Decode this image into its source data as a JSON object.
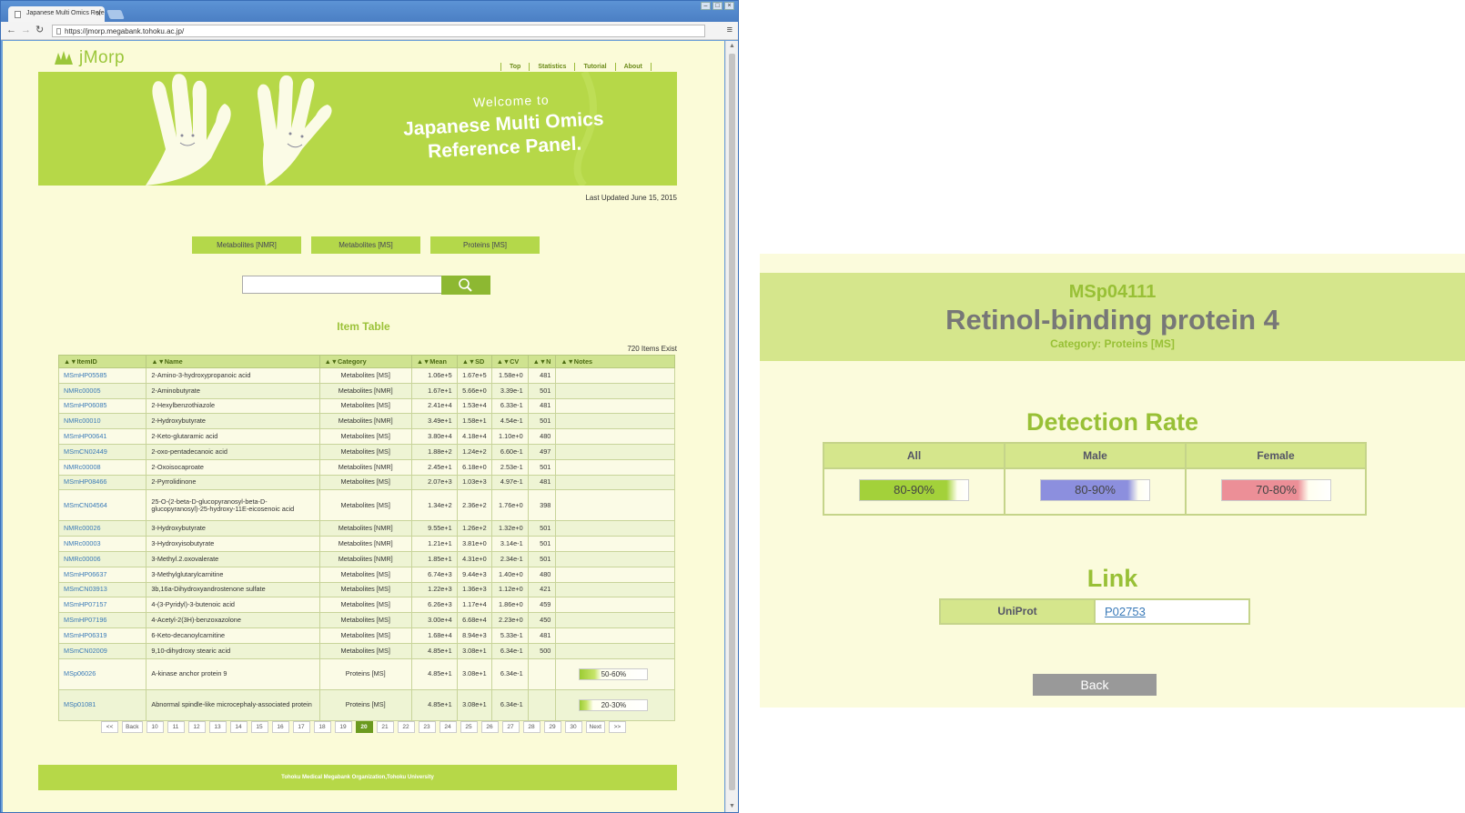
{
  "browser": {
    "tab_title": "Japanese Multi Omics Refe",
    "url": "https://jmorp.megabank.tohoku.ac.jp/"
  },
  "site": {
    "logo": "jMorp",
    "nav": [
      "Top",
      "Statistics",
      "Tutorial",
      "About"
    ],
    "banner_welcome": "Welcome to",
    "banner_title": "Japanese Multi Omics Reference Panel.",
    "last_updated": "Last Updated June 15, 2015",
    "category_buttons": [
      "Metabolites [NMR]",
      "Metabolites [MS]",
      "Proteins [MS]"
    ],
    "search_placeholder": "",
    "table_title": "Item Table",
    "items_count": "720 Items Exist",
    "columns": [
      "▲▼ItemID",
      "▲▼Name",
      "▲▼Category",
      "▲▼Mean",
      "▲▼SD",
      "▲▼CV",
      "▲▼N",
      "▲▼Notes"
    ],
    "rows": [
      {
        "id": "MSmHP05585",
        "name": "2-Amino-3-hydroxypropanoic acid",
        "cat": "Metabolites [MS]",
        "mean": "1.06e+5",
        "sd": "1.67e+5",
        "cv": "1.58e+0",
        "n": "481",
        "note": ""
      },
      {
        "id": "NMRc00005",
        "name": "2-Aminobutyrate",
        "cat": "Metabolites [NMR]",
        "mean": "1.67e+1",
        "sd": "5.66e+0",
        "cv": "3.39e-1",
        "n": "501",
        "note": ""
      },
      {
        "id": "MSmHP06085",
        "name": "2-Hexylbenzothiazole",
        "cat": "Metabolites [MS]",
        "mean": "2.41e+4",
        "sd": "1.53e+4",
        "cv": "6.33e-1",
        "n": "481",
        "note": ""
      },
      {
        "id": "NMRc00010",
        "name": "2-Hydroxybutyrate",
        "cat": "Metabolites [NMR]",
        "mean": "3.49e+1",
        "sd": "1.58e+1",
        "cv": "4.54e-1",
        "n": "501",
        "note": ""
      },
      {
        "id": "MSmHP00641",
        "name": "2-Keto-glutaramic acid",
        "cat": "Metabolites [MS]",
        "mean": "3.80e+4",
        "sd": "4.18e+4",
        "cv": "1.10e+0",
        "n": "480",
        "note": ""
      },
      {
        "id": "MSmCN02449",
        "name": "2-oxo-pentadecanoic acid",
        "cat": "Metabolites [MS]",
        "mean": "1.88e+2",
        "sd": "1.24e+2",
        "cv": "6.60e-1",
        "n": "497",
        "note": ""
      },
      {
        "id": "NMRc00008",
        "name": "2-Oxoisocaproate",
        "cat": "Metabolites [NMR]",
        "mean": "2.45e+1",
        "sd": "6.18e+0",
        "cv": "2.53e-1",
        "n": "501",
        "note": ""
      },
      {
        "id": "MSmHP08466",
        "name": "2-Pyrrolidinone",
        "cat": "Metabolites [MS]",
        "mean": "2.07e+3",
        "sd": "1.03e+3",
        "cv": "4.97e-1",
        "n": "481",
        "note": ""
      },
      {
        "id": "MSmCN04564",
        "name": "25-O-(2-beta-D-glucopyranosyl-beta-D-glucopyranosyl)-25-hydroxy-11E-eicosenoic acid",
        "cat": "Metabolites [MS]",
        "mean": "1.34e+2",
        "sd": "2.36e+2",
        "cv": "1.76e+0",
        "n": "398",
        "note": "",
        "tall": true
      },
      {
        "id": "NMRc00026",
        "name": "3-Hydroxybutyrate",
        "cat": "Metabolites [NMR]",
        "mean": "9.55e+1",
        "sd": "1.26e+2",
        "cv": "1.32e+0",
        "n": "501",
        "note": ""
      },
      {
        "id": "NMRc00003",
        "name": "3-Hydroxyisobutyrate",
        "cat": "Metabolites [NMR]",
        "mean": "1.21e+1",
        "sd": "3.81e+0",
        "cv": "3.14e-1",
        "n": "501",
        "note": ""
      },
      {
        "id": "NMRc00006",
        "name": "3-Methyl.2.oxovalerate",
        "cat": "Metabolites [NMR]",
        "mean": "1.85e+1",
        "sd": "4.31e+0",
        "cv": "2.34e-1",
        "n": "501",
        "note": ""
      },
      {
        "id": "MSmHP06637",
        "name": "3-Methylglutarylcarnitine",
        "cat": "Metabolites [MS]",
        "mean": "6.74e+3",
        "sd": "9.44e+3",
        "cv": "1.40e+0",
        "n": "480",
        "note": ""
      },
      {
        "id": "MSmCN03913",
        "name": "3b,16a-Dihydroxyandrostenone sulfate",
        "cat": "Metabolites [MS]",
        "mean": "1.22e+3",
        "sd": "1.36e+3",
        "cv": "1.12e+0",
        "n": "421",
        "note": ""
      },
      {
        "id": "MSmHP07157",
        "name": "4-(3-Pyridyl)-3-butenoic acid",
        "cat": "Metabolites [MS]",
        "mean": "6.26e+3",
        "sd": "1.17e+4",
        "cv": "1.86e+0",
        "n": "459",
        "note": ""
      },
      {
        "id": "MSmHP07196",
        "name": "4-Acetyl-2(3H)-benzoxazolone",
        "cat": "Metabolites [MS]",
        "mean": "3.00e+4",
        "sd": "6.68e+4",
        "cv": "2.23e+0",
        "n": "450",
        "note": ""
      },
      {
        "id": "MSmHP06319",
        "name": "6-Keto-decanoylcarnitine",
        "cat": "Metabolites [MS]",
        "mean": "1.68e+4",
        "sd": "8.94e+3",
        "cv": "5.33e-1",
        "n": "481",
        "note": ""
      },
      {
        "id": "MSmCN02009",
        "name": "9,10-dihydroxy stearic acid",
        "cat": "Metabolites [MS]",
        "mean": "4.85e+1",
        "sd": "3.08e+1",
        "cv": "6.34e-1",
        "n": "500",
        "note": ""
      },
      {
        "id": "MSp06026",
        "name": "A-kinase anchor protein 9",
        "cat": "Proteins [MS]",
        "mean": "4.85e+1",
        "sd": "3.08e+1",
        "cv": "6.34e-1",
        "n": "",
        "note": "50-60%",
        "pct": 55,
        "tall": true
      },
      {
        "id": "MSp01081",
        "name": "Abnormal spindle-like microcephaly-associated protein",
        "cat": "Proteins [MS]",
        "mean": "4.85e+1",
        "sd": "3.08e+1",
        "cv": "6.34e-1",
        "n": "",
        "note": "20-30%",
        "pct": 25,
        "tall": true
      }
    ],
    "pager": [
      "<<",
      "Back",
      "10",
      "11",
      "12",
      "13",
      "14",
      "15",
      "16",
      "17",
      "18",
      "19",
      "20",
      "21",
      "22",
      "23",
      "24",
      "25",
      "26",
      "27",
      "28",
      "29",
      "30",
      "Next",
      ">>"
    ],
    "pager_current": "20",
    "footer": "Tohoku Medical Megabank Organization,Tohoku University"
  },
  "detail": {
    "id": "MSp04111",
    "name": "Retinol-binding protein 4",
    "category": "Category: Proteins [MS]",
    "detection_title": "Detection Rate",
    "detection": [
      {
        "label": "All",
        "value": "80-90%",
        "color": "#a3d13a",
        "pct": 85
      },
      {
        "label": "Male",
        "value": "80-90%",
        "color": "#8c8fde",
        "pct": 85
      },
      {
        "label": "Female",
        "value": "70-80%",
        "color": "#ec8f97",
        "pct": 75
      }
    ],
    "link_title": "Link",
    "link_key": "UniProt",
    "link_value": "P02753",
    "back": "Back"
  }
}
